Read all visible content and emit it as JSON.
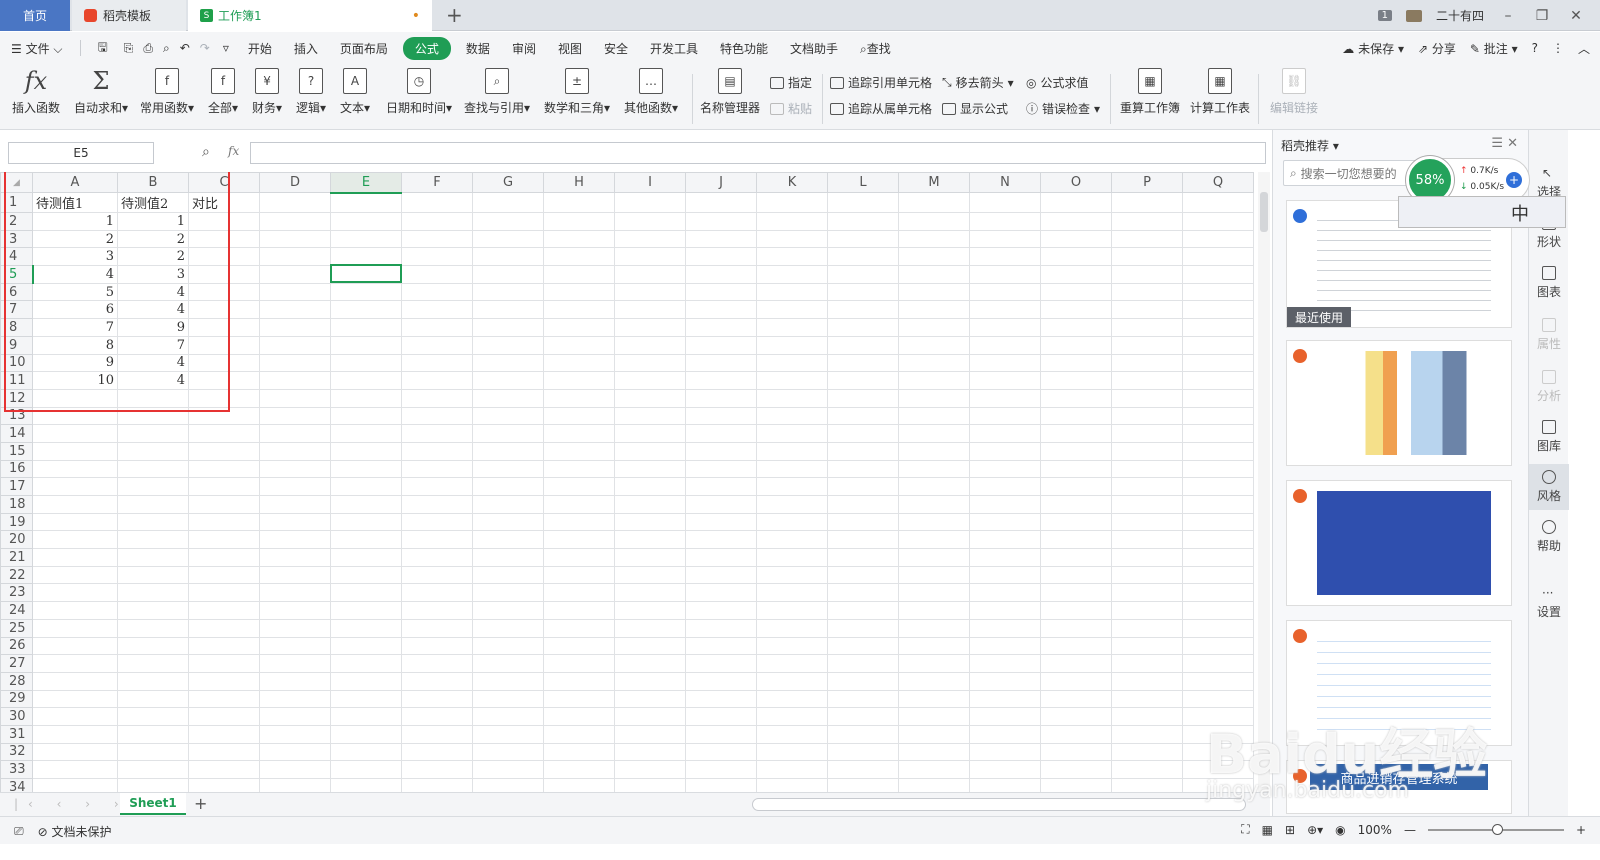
{
  "tabs": {
    "home": "首页",
    "template": "稻壳模板",
    "workbook": "工作簿1",
    "workbook_modified": "•"
  },
  "titlebar": {
    "page_badge": "1",
    "user": "二十有四"
  },
  "menu": {
    "file": "文件",
    "items": [
      "开始",
      "插入",
      "页面布局",
      "公式",
      "数据",
      "审阅",
      "视图",
      "安全",
      "开发工具",
      "特色功能",
      "文档助手"
    ],
    "active": "公式",
    "search": "查找",
    "unsaved": "未保存",
    "share": "分享",
    "comment": "批注"
  },
  "ribbon": {
    "insert_fn": "插入函数",
    "autosum": "自动求和",
    "common_fn": "常用函数",
    "all": "全部",
    "finance": "财务",
    "logic": "逻辑",
    "text": "文本",
    "datetime": "日期和时间",
    "lookup": "查找与引用",
    "math": "数学和三角",
    "other_fn": "其他函数",
    "name_mgr": "名称管理器",
    "specify": "指定",
    "paste": "粘贴",
    "trace_prec": "追踪引用单元格",
    "trace_dep": "追踪从属单元格",
    "remove_arrows": "移去箭头",
    "show_formula": "显示公式",
    "eval_formula": "公式求值",
    "error_check": "错误检查",
    "recalc_book": "重算工作簿",
    "recalc_sheet": "计算工作表",
    "edit_links": "编辑链接"
  },
  "formula_bar": {
    "name_box": "E5",
    "fx": "fx",
    "value": ""
  },
  "columns": [
    "A",
    "B",
    "C",
    "D",
    "E",
    "F",
    "G",
    "H",
    "I",
    "J",
    "K",
    "L",
    "M",
    "N",
    "O",
    "P",
    "Q"
  ],
  "selected_col": "E",
  "selected_row": "5",
  "rows": [
    {
      "n": "1",
      "a": "待测值1",
      "b": "待测值2",
      "c": "对比"
    },
    {
      "n": "2",
      "a": "1",
      "b": "1",
      "c": ""
    },
    {
      "n": "3",
      "a": "2",
      "b": "2",
      "c": ""
    },
    {
      "n": "4",
      "a": "3",
      "b": "2",
      "c": ""
    },
    {
      "n": "5",
      "a": "4",
      "b": "3",
      "c": ""
    },
    {
      "n": "6",
      "a": "5",
      "b": "4",
      "c": ""
    },
    {
      "n": "7",
      "a": "6",
      "b": "4",
      "c": ""
    },
    {
      "n": "8",
      "a": "7",
      "b": "9",
      "c": ""
    },
    {
      "n": "9",
      "a": "8",
      "b": "7",
      "c": ""
    },
    {
      "n": "10",
      "a": "9",
      "b": "4",
      "c": ""
    },
    {
      "n": "11",
      "a": "10",
      "b": "4",
      "c": ""
    },
    {
      "n": "12",
      "a": "",
      "b": "",
      "c": ""
    },
    {
      "n": "13",
      "a": "",
      "b": "",
      "c": ""
    },
    {
      "n": "14",
      "a": "",
      "b": "",
      "c": ""
    },
    {
      "n": "15",
      "a": "",
      "b": "",
      "c": ""
    },
    {
      "n": "16",
      "a": "",
      "b": "",
      "c": ""
    },
    {
      "n": "17",
      "a": "",
      "b": "",
      "c": ""
    },
    {
      "n": "18",
      "a": "",
      "b": "",
      "c": ""
    },
    {
      "n": "19",
      "a": "",
      "b": "",
      "c": ""
    },
    {
      "n": "20",
      "a": "",
      "b": "",
      "c": ""
    },
    {
      "n": "21",
      "a": "",
      "b": "",
      "c": ""
    },
    {
      "n": "22",
      "a": "",
      "b": "",
      "c": ""
    },
    {
      "n": "23",
      "a": "",
      "b": "",
      "c": ""
    },
    {
      "n": "24",
      "a": "",
      "b": "",
      "c": ""
    },
    {
      "n": "25",
      "a": "",
      "b": "",
      "c": ""
    },
    {
      "n": "26",
      "a": "",
      "b": "",
      "c": ""
    },
    {
      "n": "27",
      "a": "",
      "b": "",
      "c": ""
    },
    {
      "n": "28",
      "a": "",
      "b": "",
      "c": ""
    },
    {
      "n": "29",
      "a": "",
      "b": "",
      "c": ""
    },
    {
      "n": "30",
      "a": "",
      "b": "",
      "c": ""
    },
    {
      "n": "31",
      "a": "",
      "b": "",
      "c": ""
    },
    {
      "n": "32",
      "a": "",
      "b": "",
      "c": ""
    },
    {
      "n": "33",
      "a": "",
      "b": "",
      "c": ""
    },
    {
      "n": "34",
      "a": "",
      "b": "",
      "c": ""
    }
  ],
  "sheet_tab": "Sheet1",
  "status": {
    "protect": "文档未保护",
    "zoom": "100%"
  },
  "panel": {
    "title": "稻壳推荐",
    "search_placeholder": "搜索一切您想要的",
    "recent": "最近使用",
    "card5_title": "商品进销存管理系统"
  },
  "net_widget": {
    "percent": "58%",
    "up": "0.7K/s",
    "down": "0.05K/s"
  },
  "ime": {
    "zh": "中"
  },
  "right_tools": [
    "选择",
    "形状",
    "图表",
    "属性",
    "分析",
    "图库",
    "风格",
    "帮助",
    "设置"
  ],
  "watermark": {
    "main": "Baidu经验",
    "url": "jingyan.baidu.com"
  }
}
